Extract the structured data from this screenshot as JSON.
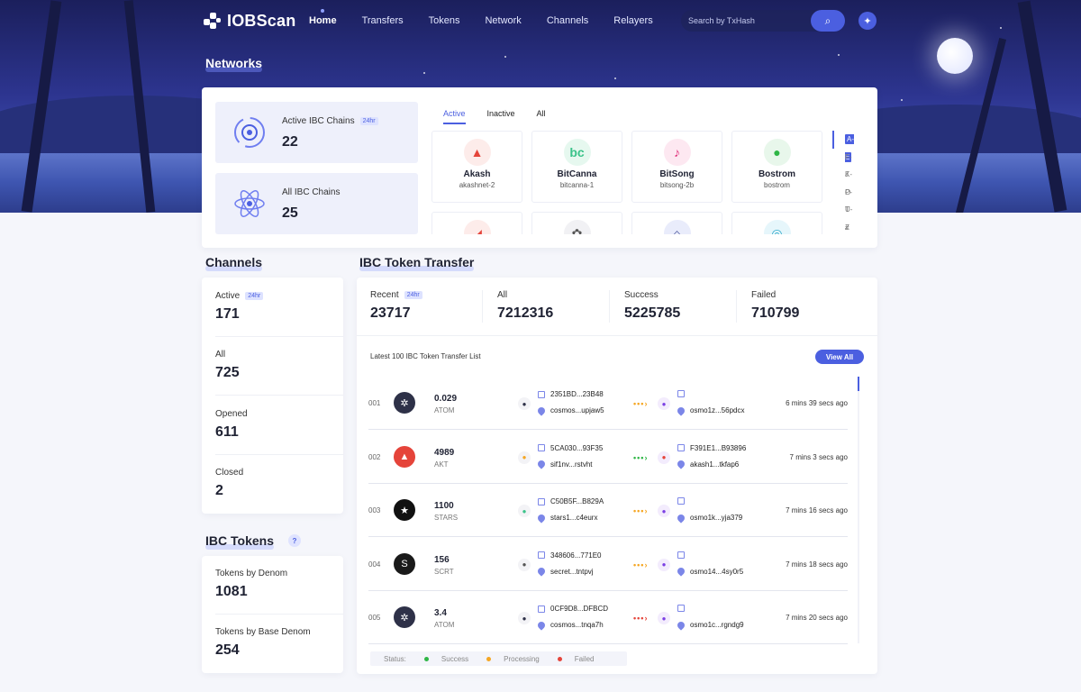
{
  "nav": {
    "brand": "IOBScan",
    "items": [
      "Home",
      "Transfers",
      "Tokens",
      "Network",
      "Channels",
      "Relayers"
    ],
    "active": "Home",
    "search_placeholder": "Search by TxHash"
  },
  "networks": {
    "title": "Networks",
    "active_chains": {
      "label": "Active IBC Chains",
      "badge": "24hr",
      "value": "22"
    },
    "all_chains": {
      "label": "All IBC Chains",
      "value": "25"
    },
    "tabs": [
      "Active",
      "Inactive",
      "All"
    ],
    "chains": [
      {
        "name": "Akash",
        "id": "akashnet-2",
        "color": "#e5443a"
      },
      {
        "name": "BitCanna",
        "id": "bitcanna-1",
        "color": "#3bc38a"
      },
      {
        "name": "BitSong",
        "id": "bitsong-2b",
        "color": "#e02f7a"
      },
      {
        "name": "Bostrom",
        "id": "bostrom",
        "color": "#2fb646"
      }
    ],
    "alphabet": [
      "A-E",
      "F-J",
      "K-O",
      "P-T",
      "U-Z",
      "#"
    ]
  },
  "channels": {
    "title": "Channels",
    "badge": "24hr",
    "items": [
      {
        "label": "Active",
        "value": "171"
      },
      {
        "label": "All",
        "value": "725"
      },
      {
        "label": "Opened",
        "value": "611"
      },
      {
        "label": "Closed",
        "value": "2"
      }
    ]
  },
  "ibc_tokens": {
    "title": "IBC Tokens",
    "help": "?",
    "items": [
      {
        "label": "Tokens by Denom",
        "value": "1081"
      },
      {
        "label": "Tokens by Base Denom",
        "value": "254"
      }
    ]
  },
  "transfer": {
    "title": "IBC Token Transfer",
    "stats": [
      {
        "label": "Recent",
        "badge": "24hr",
        "value": "23717"
      },
      {
        "label": "All",
        "value": "7212316"
      },
      {
        "label": "Success",
        "value": "5225785"
      },
      {
        "label": "Failed",
        "value": "710799"
      }
    ],
    "list_title": "Latest 100 IBC Token Transfer List",
    "view_all": "View All",
    "rows": [
      {
        "idx": "001",
        "amount": "0.029",
        "denom": "ATOM",
        "from_hash": "2351BD...23B48",
        "from_addr": "cosmos...upjaw5",
        "to_hash": "",
        "to_addr": "osmo1z...56pdcx",
        "time": "6 mins 39 secs ago",
        "status_color": "#f5a623",
        "token_color": "#2e3148",
        "token_glyph": "✲",
        "from_color": "#2e3148",
        "to_color": "#7b3fe4"
      },
      {
        "idx": "002",
        "amount": "4989",
        "denom": "AKT",
        "from_hash": "5CA030...93F35",
        "from_addr": "sif1nv...rstvht",
        "to_hash": "F391E1...B93896",
        "to_addr": "akash1...tkfap6",
        "time": "7 mins 3 secs ago",
        "status_color": "#2fb646",
        "token_color": "#e5443a",
        "token_glyph": "▲",
        "from_color": "#f5a623",
        "to_color": "#e5443a"
      },
      {
        "idx": "003",
        "amount": "1100",
        "denom": "STARS",
        "from_hash": "C50B5F...B829A",
        "from_addr": "stars1...c4eurx",
        "to_hash": "",
        "to_addr": "osmo1k...yja379",
        "time": "7 mins 16 secs ago",
        "status_color": "#f5a623",
        "token_color": "#111111",
        "token_glyph": "★",
        "from_color": "#3bc38a",
        "to_color": "#7b3fe4"
      },
      {
        "idx": "004",
        "amount": "156",
        "denom": "SCRT",
        "from_hash": "348606...771E0",
        "from_addr": "secret...tntpvj",
        "to_hash": "",
        "to_addr": "osmo14...4sy0r5",
        "time": "7 mins 18 secs ago",
        "status_color": "#f5a623",
        "token_color": "#1a1a1a",
        "token_glyph": "S",
        "from_color": "#555555",
        "to_color": "#7b3fe4"
      },
      {
        "idx": "005",
        "amount": "3.4",
        "denom": "ATOM",
        "from_hash": "0CF9D8...DFBCD",
        "from_addr": "cosmos...tnqa7h",
        "to_hash": "",
        "to_addr": "osmo1c...rgndg9",
        "time": "7 mins 20 secs ago",
        "status_color": "#e5443a",
        "token_color": "#2e3148",
        "token_glyph": "✲",
        "from_color": "#2e3148",
        "to_color": "#7b3fe4"
      }
    ],
    "legend": {
      "label": "Status:",
      "success": "Success",
      "processing": "Processing",
      "failed": "Failed",
      "colors": {
        "success": "#2fb646",
        "processing": "#f5a623",
        "failed": "#e5443a"
      }
    }
  }
}
